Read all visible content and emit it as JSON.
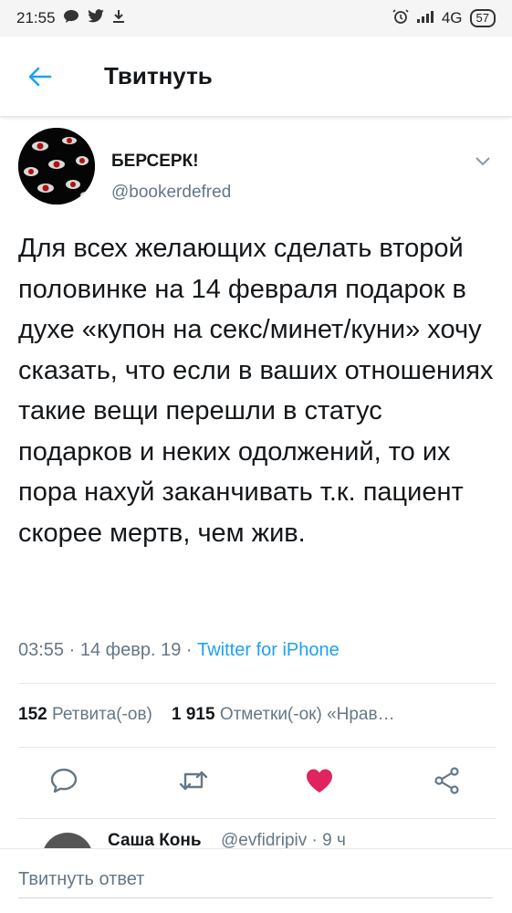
{
  "status_bar": {
    "time": "21:55",
    "network": "4G",
    "battery": "57"
  },
  "header": {
    "title": "Твитнуть"
  },
  "tweet": {
    "display_name": "БЕРСЕРК!",
    "handle": "@bookerdefred",
    "text": "Для всех желающих сделать второй половинке на 14 февраля подарок в духе «купон на секс/минет/куни» хочу сказать, что если в ваших отношениях такие вещи перешли в статус подарков и неких одолжений, то их пора нахуй заканчивать т.к. пациент скорее мертв, чем жив.",
    "time": "03:55",
    "date": "14 февр. 19",
    "source": "Twitter for iPhone",
    "retweets_count": "152",
    "retweets_label": "Ретвита(-ов)",
    "likes_count": "1 915",
    "likes_label": "Отметки(-ок) «Нрав…"
  },
  "actions": {
    "reply": "reply-icon",
    "retweet": "retweet-icon",
    "like": "heart-icon",
    "share": "share-icon",
    "like_color": "#e0245e"
  },
  "reply_preview": {
    "name": "Саша Конь",
    "handle": "@evfidripiv · 9 ч"
  },
  "compose": {
    "placeholder": "Твитнуть ответ"
  },
  "colors": {
    "accent": "#1da1f2",
    "secondary_text": "#657786"
  }
}
